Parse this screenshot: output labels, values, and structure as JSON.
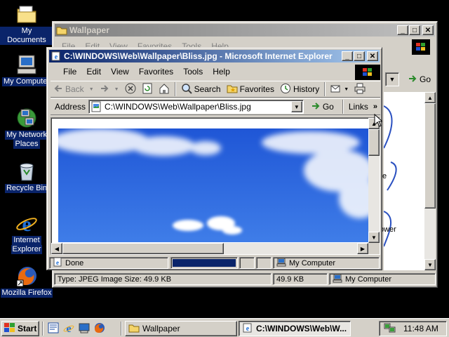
{
  "desktop": {
    "icons": [
      {
        "label": "My Documents"
      },
      {
        "label": "My Computer"
      },
      {
        "label": "My Network",
        "label2": "Places"
      },
      {
        "label": "Recycle Bin"
      },
      {
        "label": "Internet",
        "label2": "Explorer"
      },
      {
        "label": "Mozilla Firefox"
      }
    ]
  },
  "explorer": {
    "title": "Wallpaper",
    "menu": [
      "File",
      "Edit",
      "View",
      "Favorites",
      "Tools",
      "Help"
    ],
    "go_label": "Go",
    "side_text": [
      "e",
      "ower"
    ],
    "status": {
      "info": "Type: JPEG Image Size: 49.9 KB",
      "size": "49.9 KB",
      "zone": "My Computer"
    }
  },
  "ie": {
    "title": "C:\\WINDOWS\\Web\\Wallpaper\\Bliss.jpg - Microsoft Internet Explorer",
    "menu": [
      "File",
      "Edit",
      "View",
      "Favorites",
      "Tools",
      "Help"
    ],
    "toolbar": {
      "back": "Back",
      "search": "Search",
      "favorites": "Favorites",
      "history": "History"
    },
    "address": {
      "label": "Address",
      "value": "C:\\WINDOWS\\Web\\Wallpaper\\Bliss.jpg",
      "go": "Go",
      "links": "Links"
    },
    "status": {
      "text": "Done",
      "zone": "My Computer",
      "progress": 1.0
    },
    "colors": {
      "sky_top": "#1f56d6",
      "sky_bottom": "#3f7de8"
    }
  },
  "taskbar": {
    "start": "Start",
    "tasks": [
      {
        "label": "Wallpaper"
      },
      {
        "label": "C:\\WINDOWS\\Web\\W..."
      }
    ],
    "clock": "11:48 AM"
  }
}
